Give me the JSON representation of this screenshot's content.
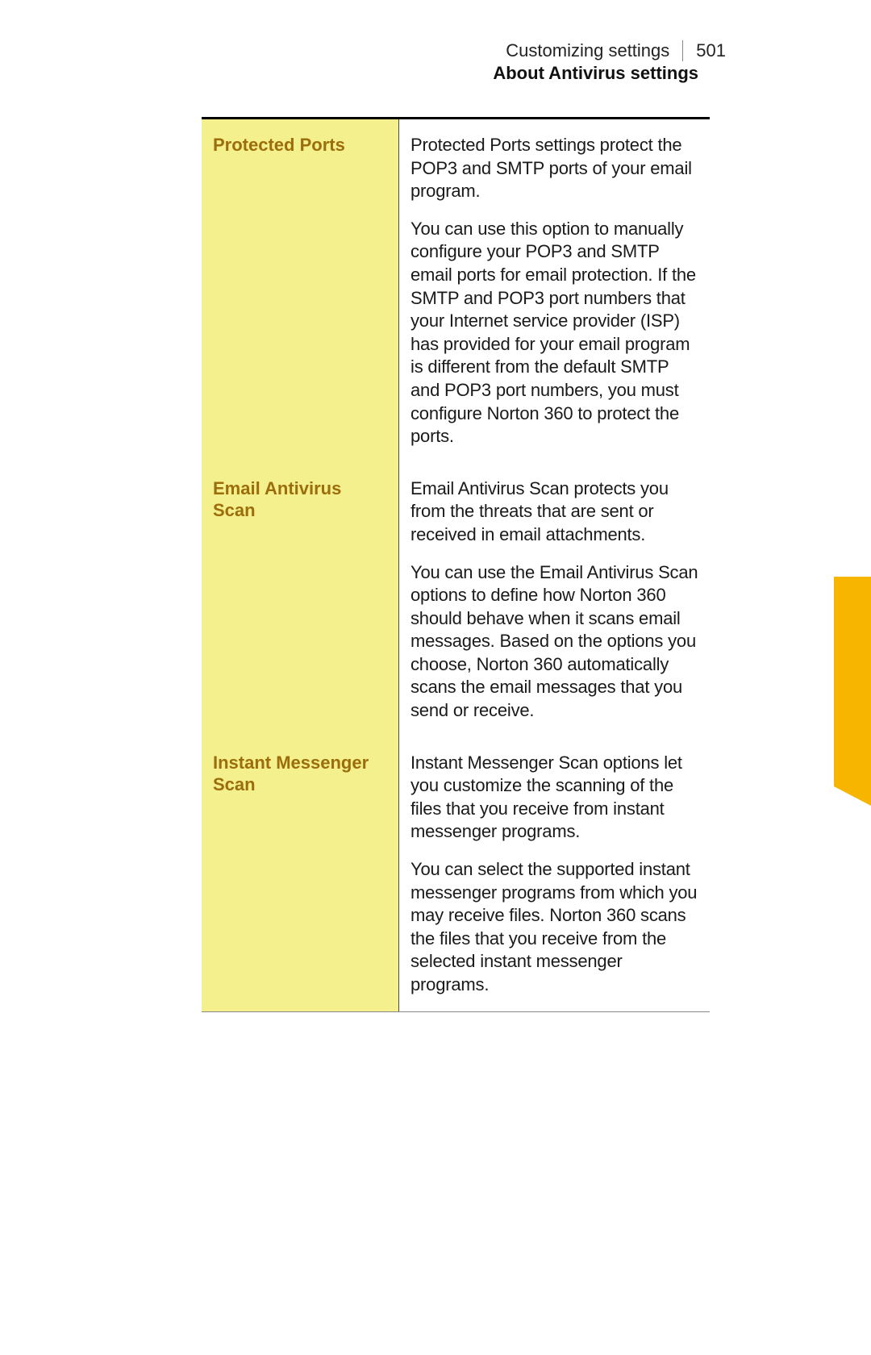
{
  "header": {
    "section": "Customizing settings",
    "page_number": "501",
    "title": "About Antivirus settings"
  },
  "rows": [
    {
      "label": "Protected Ports",
      "paragraphs": [
        "Protected Ports settings protect the POP3 and SMTP ports of your email program.",
        "You can use this option to manually configure your POP3 and SMTP email ports for email protection. If the SMTP and POP3 port numbers that your Internet service provider (ISP) has provided for your email program is different from the default SMTP and POP3 port numbers, you must configure Norton 360 to protect the ports."
      ]
    },
    {
      "label": "Email Antivirus Scan",
      "paragraphs": [
        "Email Antivirus Scan protects you from the threats that are sent or received in email attachments.",
        "You can use the Email Antivirus Scan options to define how Norton 360 should behave when it scans email messages. Based on the options you choose, Norton 360 automatically scans the email messages that you send or receive."
      ]
    },
    {
      "label": "Instant Messenger Scan",
      "paragraphs": [
        "Instant Messenger Scan options let you customize the scanning of the files that you receive from instant messenger programs.",
        "You can select the supported instant messenger programs from which you may receive files. Norton 360 scans the files that you receive from the selected instant messenger programs."
      ]
    }
  ]
}
